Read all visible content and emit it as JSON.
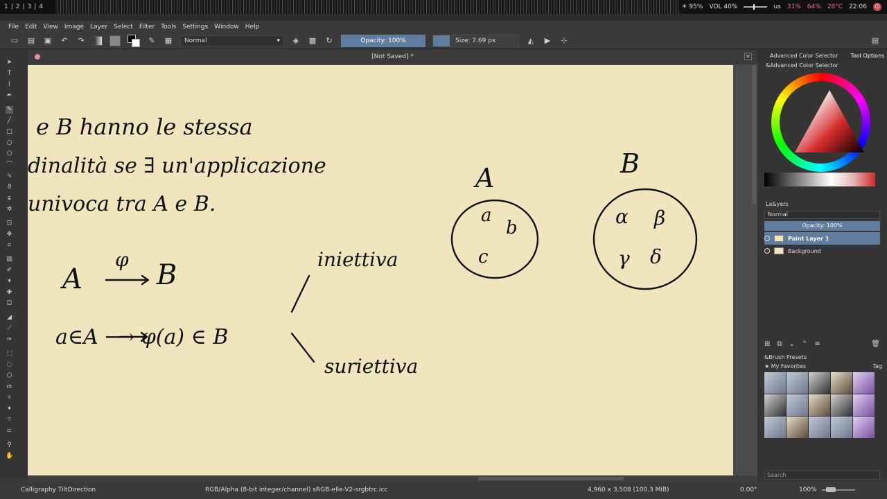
{
  "topbar": {
    "workspaces": [
      "1",
      "|",
      "2",
      "|",
      "3",
      "|",
      "4"
    ],
    "brightness": "☀ 95%",
    "volume": "VOL 40%",
    "keyboard": "us",
    "cpu": "31%",
    "mem": "64%",
    "temp": "28°C",
    "clock": "22:06"
  },
  "menu": [
    "File",
    "Edit",
    "View",
    "Image",
    "Layer",
    "Select",
    "Filter",
    "Tools",
    "Settings",
    "Window",
    "Help"
  ],
  "toolbar": {
    "blend_mode": "Normal",
    "opacity": "Opacity: 100%",
    "size": "Size: 7.69 px"
  },
  "document": {
    "title": "[Not Saved]  *"
  },
  "canvas_text": {
    "line1": "e B  hanno  le  stessa",
    "line2": "dinalità  se  ∃  un'applicazione",
    "line3": "univoca  tra  A  e  B.",
    "map": "A  ⟶  B",
    "phi": "φ",
    "elem": "a∈A  ⟶  φ(a) ∈ B",
    "iniettiva": "iniettiva",
    "suriettiva": "suriettiva",
    "setA_label": "A",
    "setB_label": "B",
    "setA_a": "a",
    "setA_b": "b",
    "setA_c": "c",
    "setB_alpha": "α",
    "setB_beta": "β",
    "setB_gamma": "γ",
    "setB_delta": "δ"
  },
  "dock": {
    "tab1": "Advanced Color Selector",
    "tab2": "Tool Options",
    "color_panel_title": "&Advanced Color Selector",
    "layers_title": "La&yers",
    "layers_blend": "Normal",
    "layers_opacity": "Opacity:  100%",
    "layer1": "Paint Layer 1",
    "layer2": "Background",
    "brush_title": "&Brush Presets",
    "brush_tag": "★ My Favorites",
    "tag_label": "Tag",
    "search_placeholder": "Search"
  },
  "statusbar": {
    "tool": "Calligraphy TiltDirection",
    "colorspace": "RGB/Alpha (8-bit integer/channel)  sRGB-elle-V2-srgbtrc.icc",
    "dimensions": "4,960 x 3,508 (100.3 MiB)",
    "rotation": "0.00°",
    "zoom": "100%"
  },
  "colors": {
    "accent": "#5f7d9e",
    "paper": "#f0e6be",
    "ink": "#111111"
  }
}
